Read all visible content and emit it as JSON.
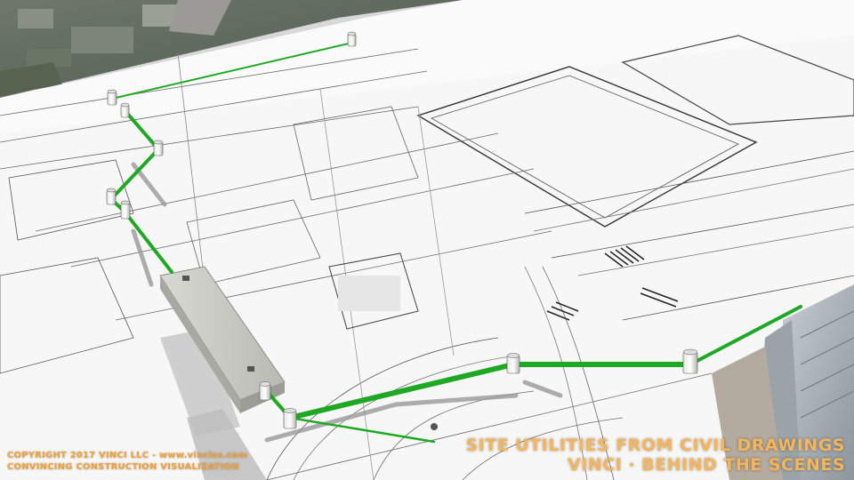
{
  "overlay": {
    "copyright": "COPYRIGHT 2017 VINCI LLC - www.vinciss.com",
    "tagline": "CONVINCING CONSTRUCTION VISUALIZATION",
    "title": "SITE UTILITIES FROM CIVIL DRAWINGS",
    "subtitle": "VINCI · BEHIND THE SCENES"
  },
  "colors": {
    "pipe": "#1fa824",
    "title_text": "#f7b55a",
    "caption_text": "#f2a23a",
    "sheet": "#f7f7f7",
    "aerial": "#5f6b5d"
  },
  "scene": {
    "description_icons": [
      "aerial-photo",
      "civil-drawing-sheet",
      "utility-pipe",
      "manhole-structure",
      "concrete-vault",
      "building-facade"
    ]
  }
}
